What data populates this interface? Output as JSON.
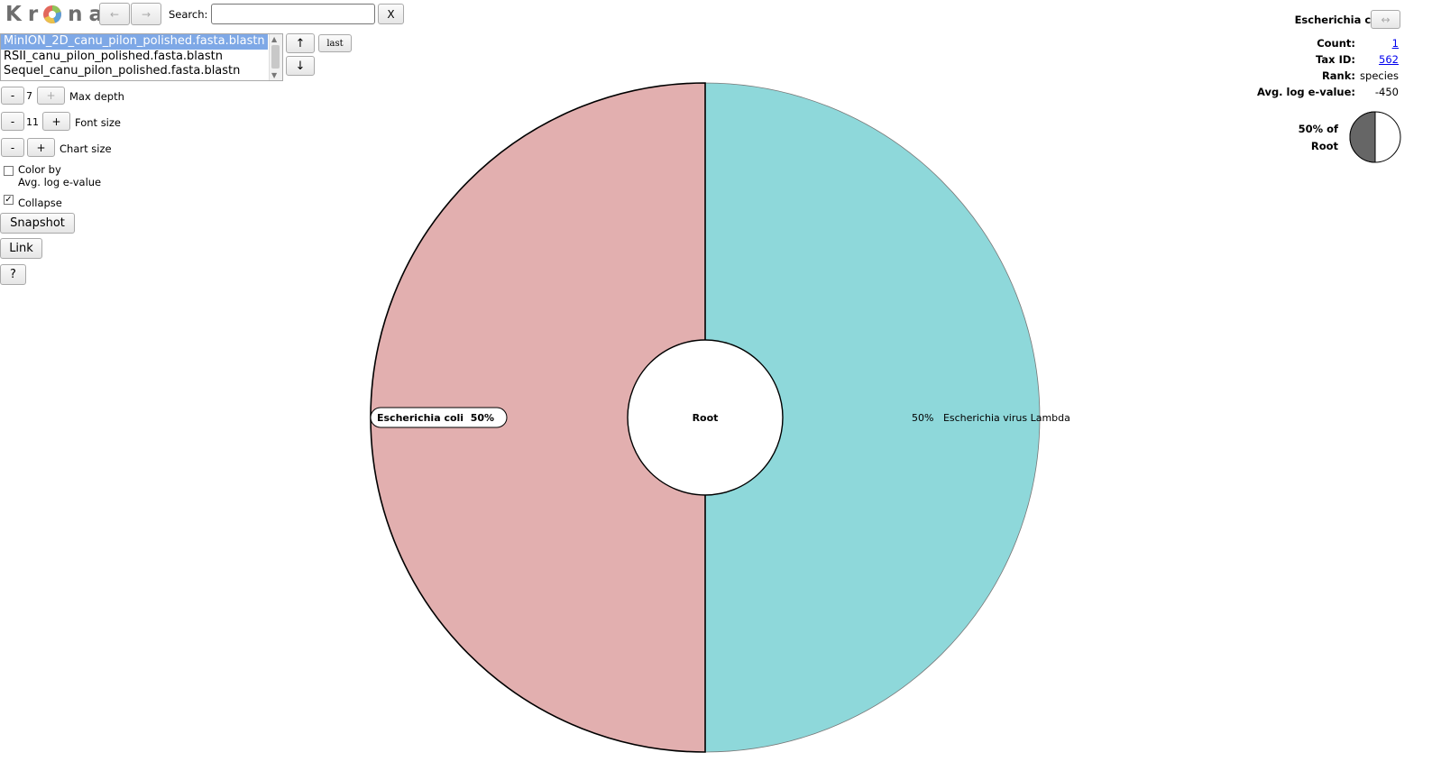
{
  "logo": {
    "text_left": "Kr",
    "text_right": "na"
  },
  "nav": {
    "back_label": "←",
    "forward_label": "→"
  },
  "search": {
    "label": "Search:",
    "value": "",
    "clear_label": "X"
  },
  "datasets": {
    "items": [
      "MinION_2D_canu_pilon_polished.fasta.blastn",
      "RSII_canu_pilon_polished.fasta.blastn",
      "Sequel_canu_pilon_polished.fasta.blastn"
    ],
    "selected_index": 0,
    "up_label": "↑",
    "last_label": "last",
    "down_label": "↓"
  },
  "controls": {
    "max_depth": {
      "minus": "-",
      "value": "7",
      "plus": "+",
      "label": "Max depth"
    },
    "font_size": {
      "minus": "-",
      "value": "11",
      "plus": "+",
      "label": "Font size"
    },
    "chart_size": {
      "minus": "-",
      "plus": "+",
      "label": "Chart size"
    },
    "color_by": {
      "label_line1": "Color by",
      "label_line2": "Avg. log e-value",
      "checked": false
    },
    "collapse": {
      "label": "Collapse",
      "checked": true
    },
    "snapshot_label": "Snapshot",
    "link_label": "Link",
    "help_label": "?"
  },
  "details": {
    "name": "Escherichia coli",
    "expand_label": "↔",
    "count_label": "Count:",
    "count_value": "1",
    "taxid_label": "Tax ID:",
    "taxid_value": "562",
    "rank_label": "Rank:",
    "rank_value": "species",
    "evalue_label": "Avg. log e-value:",
    "evalue_value": "-450",
    "percent_line1": "50% of",
    "percent_line2": "Root",
    "percent_fraction": 0.5
  },
  "chart_data": {
    "type": "pie",
    "center_label": "Root",
    "slices": [
      {
        "name": "Escherichia virus Lambda",
        "percent_label": "50%",
        "value": 50,
        "color": "#8ed8da"
      },
      {
        "name": "Escherichia coli",
        "percent_label": "50%",
        "value": 50,
        "color": "#e2afaf",
        "selected": true
      }
    ]
  }
}
